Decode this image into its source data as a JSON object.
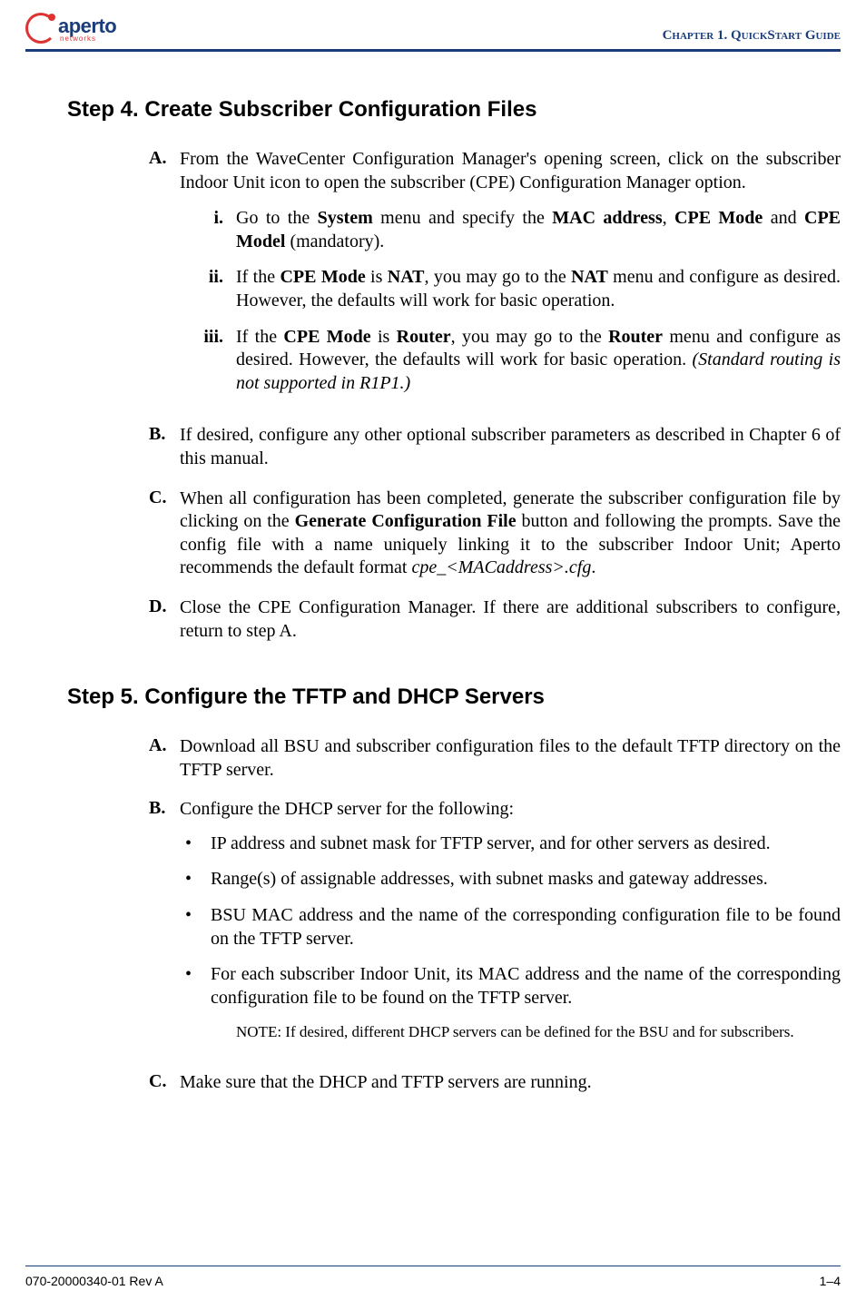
{
  "header": {
    "logo_text": "aperto",
    "logo_sub": "networks",
    "chapter": "Chapter 1.  QuickStart Guide"
  },
  "step4": {
    "title": "Step 4.  Create Subscriber Configuration Files",
    "A": {
      "marker": "A.",
      "text_pre": "From the WaveCenter Configuration Manager's opening screen, click on the subscriber Indoor Unit icon to open the subscriber (CPE) Configuration Manager option.",
      "i": {
        "marker": "i.",
        "t1": "Go to the ",
        "b1": "System",
        "t2": " menu and specify the ",
        "b2": "MAC address",
        "t3": ", ",
        "b3": "CPE Mode",
        "t4": " and ",
        "b4": "CPE Model",
        "t5": " (mandatory)."
      },
      "ii": {
        "marker": "ii.",
        "t1": "If the ",
        "b1": "CPE Mode",
        "t2": " is ",
        "b2": "NAT",
        "t3": ", you may go to the ",
        "b3": "NAT",
        "t4": " menu and configure as desired. However, the defaults will work for basic operation."
      },
      "iii": {
        "marker": "iii.",
        "t1": "If the ",
        "b1": "CPE Mode",
        "t2": " is ",
        "b2": "Router",
        "t3": ", you may go to the ",
        "b3": "Router",
        "t4": " menu and configure as desired. However, the defaults will work for basic operation. ",
        "i1": "(Standard routing is not supported in R1P1.)"
      }
    },
    "B": {
      "marker": "B.",
      "text": "If desired, configure any other optional subscriber parameters as described in Chapter 6 of this manual."
    },
    "C": {
      "marker": "C.",
      "t1": "When all configuration has been completed, generate the subscriber configuration file by clicking on the ",
      "b1": "Generate Configuration File",
      "t2": " button and following the prompts. Save the config file with a name uniquely linking it to the subscriber Indoor Unit; Aperto recommends the default format ",
      "i1": "cpe_<MACaddress>.cfg",
      "t3": "."
    },
    "D": {
      "marker": "D.",
      "text": "Close the CPE Configuration Manager. If there are additional subscribers to configure, return to step A."
    }
  },
  "step5": {
    "title": "Step 5.  Configure the TFTP and DHCP Servers",
    "A": {
      "marker": "A.",
      "text": "Download all BSU and subscriber configuration files to the default TFTP directory on the TFTP server."
    },
    "B": {
      "marker": "B.",
      "text": "Configure the DHCP server for the following:",
      "bullets": [
        "IP address and subnet mask for TFTP server, and for other servers as desired.",
        "Range(s) of assignable addresses, with subnet masks and gateway addresses.",
        "BSU MAC address and the name of the corresponding configuration file to be found on the TFTP server.",
        "For each subscriber Indoor Unit, its MAC address and the name of the corresponding configuration file to be found on the TFTP server."
      ],
      "note": "NOTE:  If desired, different DHCP servers can be defined for the BSU and for subscribers."
    },
    "C": {
      "marker": "C.",
      "text": "Make sure that the DHCP and TFTP servers are running."
    }
  },
  "footer": {
    "left": "070-20000340-01 Rev A",
    "right": "1–4"
  }
}
